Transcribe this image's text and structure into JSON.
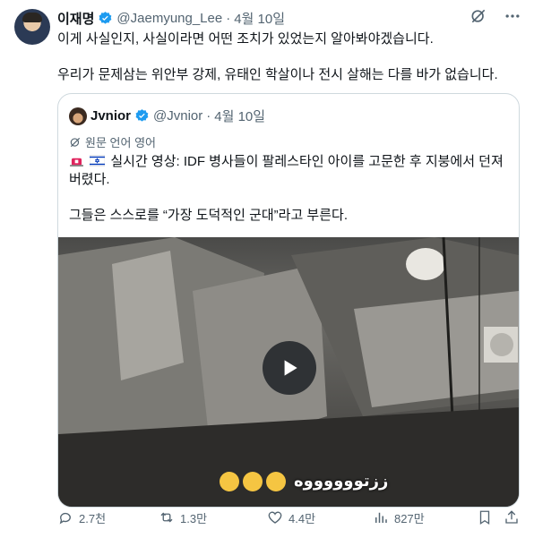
{
  "author": {
    "name": "이재명",
    "handle": "@Jaemyung_Lee",
    "separator": "·",
    "time": "4월 10일"
  },
  "tweet": {
    "line1": "이게 사실인지, 사실이라면 어떤 조치가 있었는지 알아봐야겠습니다.",
    "line2": "우리가 문제삼는 위안부 강제, 유태인 학살이나 전시 살해는 다를 바가 없습니다."
  },
  "quote": {
    "name": "Jvnior",
    "handle": "@Jvnior",
    "separator": "·",
    "time": "4월 10일",
    "translate_label": "원문 언어 영어",
    "text1": "실시간 영상: IDF 병사들이 팔레스타인 아이를 고문한 후 지붕에서 던져버렸다.",
    "text2": "그들은 스스로를 “가장 도덕적인 군대”라고 부른다.",
    "video_caption": "ززتووووووه"
  },
  "actions": {
    "replies": "2.7천",
    "retweets": "1.3만",
    "likes": "4.4만",
    "views": "827만"
  },
  "colors": {
    "text": "#0f1419",
    "muted": "#536471",
    "verified": "#1d9bf0",
    "border": "#cfd9de"
  }
}
